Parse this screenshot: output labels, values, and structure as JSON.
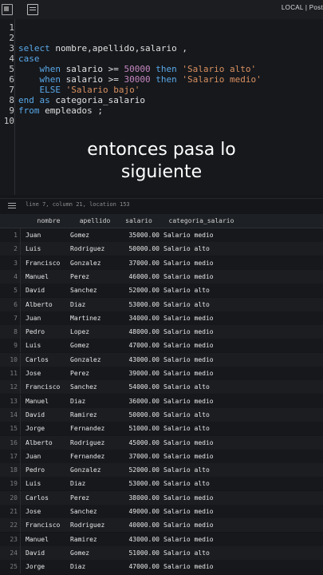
{
  "topbar": {
    "connection_label": "LOCAL | Post"
  },
  "editor": {
    "lines": [
      {
        "n": "1",
        "tokens": []
      },
      {
        "n": "2",
        "tokens": []
      },
      {
        "n": "3",
        "tokens": [
          {
            "t": "kw",
            "v": "select"
          },
          {
            "t": "plain",
            "v": " nombre,apellido,salario ,"
          }
        ]
      },
      {
        "n": "4",
        "tokens": [
          {
            "t": "kw",
            "v": "case"
          }
        ]
      },
      {
        "n": "5",
        "tokens": [
          {
            "t": "plain",
            "v": "    "
          },
          {
            "t": "kw",
            "v": "when"
          },
          {
            "t": "plain",
            "v": " salario >= "
          },
          {
            "t": "num",
            "v": "50000"
          },
          {
            "t": "plain",
            "v": " "
          },
          {
            "t": "kw",
            "v": "then"
          },
          {
            "t": "plain",
            "v": " "
          },
          {
            "t": "str",
            "v": "'Salario alto'"
          }
        ]
      },
      {
        "n": "6",
        "tokens": [
          {
            "t": "plain",
            "v": "    "
          },
          {
            "t": "kw",
            "v": "when"
          },
          {
            "t": "plain",
            "v": " salario >= "
          },
          {
            "t": "num",
            "v": "30000"
          },
          {
            "t": "plain",
            "v": " "
          },
          {
            "t": "kw",
            "v": "then"
          },
          {
            "t": "plain",
            "v": " "
          },
          {
            "t": "str",
            "v": "'Salario medio'"
          }
        ]
      },
      {
        "n": "7",
        "tokens": [
          {
            "t": "plain",
            "v": "    "
          },
          {
            "t": "kw",
            "v": "ELSE"
          },
          {
            "t": "plain",
            "v": " "
          },
          {
            "t": "str",
            "v": "'Salario bajo'"
          }
        ]
      },
      {
        "n": "8",
        "tokens": [
          {
            "t": "kw",
            "v": "end as"
          },
          {
            "t": "plain",
            "v": " categoria_salario"
          }
        ]
      },
      {
        "n": "9",
        "tokens": [
          {
            "t": "kw",
            "v": "from"
          },
          {
            "t": "plain",
            "v": " empleados ;"
          }
        ]
      },
      {
        "n": "10",
        "tokens": []
      }
    ]
  },
  "caption": {
    "line1": "entonces pasa lo",
    "line2": "siguiente"
  },
  "status": {
    "position_text": "line 7, column 21, location 153"
  },
  "results": {
    "columns": [
      "nombre",
      "apellido",
      "salario",
      "categoria_salario"
    ],
    "rows": [
      [
        "1",
        "Juan",
        "Gomez",
        "35000.00",
        "Salario medio"
      ],
      [
        "2",
        "Luis",
        "Rodriguez",
        "50000.00",
        "Salario alto"
      ],
      [
        "3",
        "Francisco",
        "Gonzalez",
        "37000.00",
        "Salario medio"
      ],
      [
        "4",
        "Manuel",
        "Perez",
        "46000.00",
        "Salario medio"
      ],
      [
        "5",
        "David",
        "Sanchez",
        "52000.00",
        "Salario alto"
      ],
      [
        "6",
        "Alberto",
        "Diaz",
        "53000.00",
        "Salario alto"
      ],
      [
        "7",
        "Juan",
        "Martinez",
        "34000.00",
        "Salario medio"
      ],
      [
        "8",
        "Pedro",
        "Lopez",
        "48000.00",
        "Salario medio"
      ],
      [
        "9",
        "Luis",
        "Gomez",
        "47000.00",
        "Salario medio"
      ],
      [
        "10",
        "Carlos",
        "Gonzalez",
        "43000.00",
        "Salario medio"
      ],
      [
        "11",
        "Jose",
        "Perez",
        "39000.00",
        "Salario medio"
      ],
      [
        "12",
        "Francisco",
        "Sanchez",
        "54000.00",
        "Salario alto"
      ],
      [
        "13",
        "Manuel",
        "Diaz",
        "36000.00",
        "Salario medio"
      ],
      [
        "14",
        "David",
        "Ramirez",
        "50000.00",
        "Salario alto"
      ],
      [
        "15",
        "Jorge",
        "Fernandez",
        "51000.00",
        "Salario alto"
      ],
      [
        "16",
        "Alberto",
        "Rodriguez",
        "45000.00",
        "Salario medio"
      ],
      [
        "17",
        "Juan",
        "Fernandez",
        "37000.00",
        "Salario medio"
      ],
      [
        "18",
        "Pedro",
        "Gonzalez",
        "52000.00",
        "Salario alto"
      ],
      [
        "19",
        "Luis",
        "Diaz",
        "53000.00",
        "Salario alto"
      ],
      [
        "20",
        "Carlos",
        "Perez",
        "38000.00",
        "Salario medio"
      ],
      [
        "21",
        "Jose",
        "Sanchez",
        "49000.00",
        "Salario medio"
      ],
      [
        "22",
        "Francisco",
        "Rodriguez",
        "40000.00",
        "Salario medio"
      ],
      [
        "23",
        "Manuel",
        "Ramirez",
        "43000.00",
        "Salario medio"
      ],
      [
        "24",
        "David",
        "Gomez",
        "51000.00",
        "Salario alto"
      ],
      [
        "25",
        "Jorge",
        "Diaz",
        "47000.00",
        "Salario medio"
      ]
    ]
  }
}
